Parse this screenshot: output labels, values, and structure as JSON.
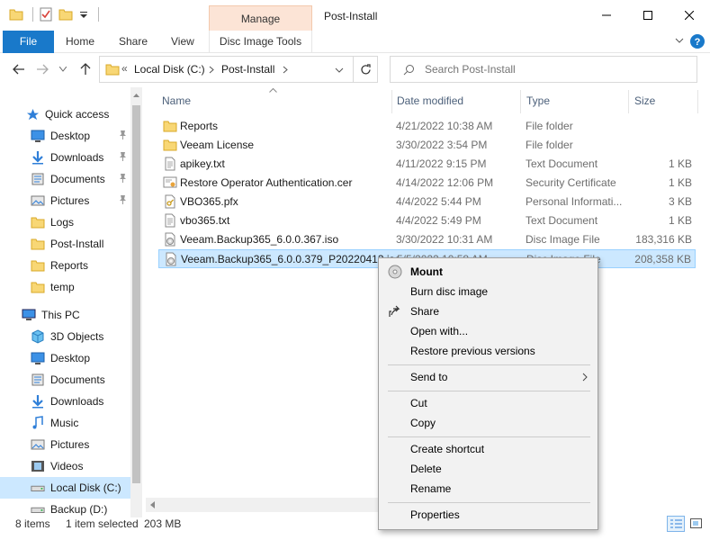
{
  "window": {
    "title": "Post-Install",
    "manage_tab": "Manage",
    "ribbon_tabs": [
      "File",
      "Home",
      "Share",
      "View",
      "Disc Image Tools"
    ]
  },
  "address": {
    "crumb_overflow": "«",
    "crumbs": [
      "Local Disk (C:)",
      "Post-Install"
    ],
    "search_placeholder": "Search Post-Install"
  },
  "nav": {
    "quick_access": "Quick access",
    "quick_items": [
      {
        "label": "Desktop",
        "icon": "desktop-icon",
        "pinned": true
      },
      {
        "label": "Downloads",
        "icon": "downloads-icon",
        "pinned": true
      },
      {
        "label": "Documents",
        "icon": "documents-icon",
        "pinned": true
      },
      {
        "label": "Pictures",
        "icon": "pictures-icon",
        "pinned": true
      },
      {
        "label": "Logs",
        "icon": "folder-icon",
        "pinned": false
      },
      {
        "label": "Post-Install",
        "icon": "folder-icon",
        "pinned": false
      },
      {
        "label": "Reports",
        "icon": "folder-icon",
        "pinned": false
      },
      {
        "label": "temp",
        "icon": "folder-icon",
        "pinned": false
      }
    ],
    "this_pc": "This PC",
    "pc_items": [
      {
        "label": "3D Objects",
        "icon": "3d-objects-icon"
      },
      {
        "label": "Desktop",
        "icon": "desktop-icon"
      },
      {
        "label": "Documents",
        "icon": "documents-icon"
      },
      {
        "label": "Downloads",
        "icon": "downloads-icon"
      },
      {
        "label": "Music",
        "icon": "music-icon"
      },
      {
        "label": "Pictures",
        "icon": "pictures-icon"
      },
      {
        "label": "Videos",
        "icon": "videos-icon"
      },
      {
        "label": "Local Disk (C:)",
        "icon": "drive-icon",
        "selected": true
      },
      {
        "label": "Backup (D:)",
        "icon": "drive-icon"
      }
    ]
  },
  "columns": {
    "name": "Name",
    "date": "Date modified",
    "type": "Type",
    "size": "Size"
  },
  "files": [
    {
      "name": "Reports",
      "date": "4/21/2022 10:38 AM",
      "type": "File folder",
      "size": "",
      "icon": "folder"
    },
    {
      "name": "Veeam License",
      "date": "3/30/2022 3:54 PM",
      "type": "File folder",
      "size": "",
      "icon": "folder"
    },
    {
      "name": "apikey.txt",
      "date": "4/11/2022 9:15 PM",
      "type": "Text Document",
      "size": "1 KB",
      "icon": "text"
    },
    {
      "name": "Restore Operator Authentication.cer",
      "date": "4/14/2022 12:06 PM",
      "type": "Security Certificate",
      "size": "1 KB",
      "icon": "cert"
    },
    {
      "name": "VBO365.pfx",
      "date": "4/4/2022 5:44 PM",
      "type": "Personal Informati...",
      "size": "3 KB",
      "icon": "pfx"
    },
    {
      "name": "vbo365.txt",
      "date": "4/4/2022 5:49 PM",
      "type": "Text Document",
      "size": "1 KB",
      "icon": "text"
    },
    {
      "name": "Veeam.Backup365_6.0.0.367.iso",
      "date": "3/30/2022 10:31 AM",
      "type": "Disc Image File",
      "size": "183,316 KB",
      "icon": "iso"
    },
    {
      "name": "Veeam.Backup365_6.0.0.379_P20220413.iso",
      "date": "5/5/2022 10:58 AM",
      "type": "Disc Image File",
      "size": "208,358 KB",
      "icon": "iso",
      "selected": true
    }
  ],
  "status": {
    "count": "8 items",
    "selection": "1 item selected",
    "size": "203 MB"
  },
  "context_menu": {
    "mount": "Mount",
    "burn": "Burn disc image",
    "share": "Share",
    "open_with": "Open with...",
    "restore": "Restore previous versions",
    "send_to": "Send to",
    "cut": "Cut",
    "copy": "Copy",
    "create_shortcut": "Create shortcut",
    "delete": "Delete",
    "rename": "Rename",
    "properties": "Properties"
  },
  "colors": {
    "accent": "#1979ca",
    "selection": "#cce8ff",
    "manage_tab": "#fce4d6",
    "folder": "#f8d775"
  }
}
